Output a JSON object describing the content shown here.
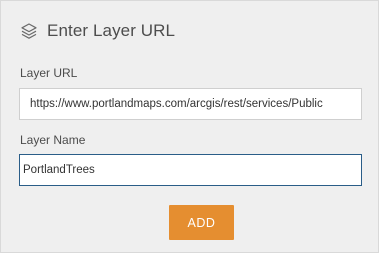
{
  "panel": {
    "title": "Enter Layer URL",
    "title_icon": "layers-icon"
  },
  "form": {
    "url_label": "Layer URL",
    "url_value": "https://www.portlandmaps.com/arcgis/rest/services/Public",
    "name_label": "Layer Name",
    "name_value": "PortlandTrees",
    "add_label": "ADD"
  },
  "colors": {
    "accent_button": "#e58e30",
    "focus_border": "#2a5d88",
    "panel_background": "#efefef"
  }
}
